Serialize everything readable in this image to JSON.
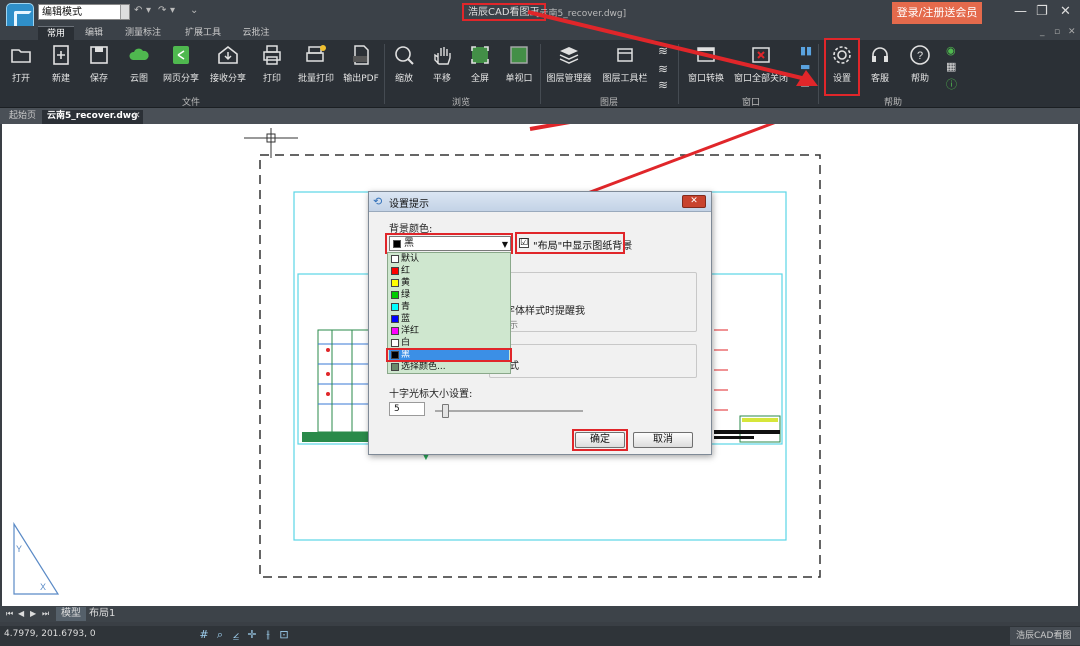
{
  "titlebar": {
    "mode_select": "编辑模式",
    "app_title": "浩辰CAD看图王",
    "file_title": "[云南5_recover.dwg]",
    "login_button": "登录/注册送会员"
  },
  "menu_tabs": [
    "常用",
    "编辑",
    "测量标注",
    "扩展工具",
    "云批注"
  ],
  "ribbon": {
    "file_buttons": [
      "打开",
      "新建",
      "保存",
      "云图",
      "网页分享",
      "接收分享",
      "打印",
      "批量打印",
      "输出PDF"
    ],
    "view_buttons": [
      "缩放",
      "平移",
      "全屏",
      "单视口"
    ],
    "layer_buttons": [
      "图层管理器",
      "图层工具栏"
    ],
    "window_buttons": [
      "窗口转换",
      "窗口全部关闭"
    ],
    "help_buttons": [
      "设置",
      "客服",
      "帮助"
    ],
    "groups": [
      "文件",
      "浏览",
      "图层",
      "窗口",
      "帮助"
    ]
  },
  "doc_tabs": {
    "start": "起始页",
    "file": "云南5_recover.dwg",
    "close": "✕"
  },
  "layout_tabs": {
    "nav": [
      "⏮",
      "◀",
      "▶",
      "⏭"
    ],
    "model": "模型",
    "layout1": "布局1"
  },
  "status": {
    "coords": "4.7979, 201.6793, 0",
    "app_name": "浩辰CAD看图王"
  },
  "dialog": {
    "title": "设置提示",
    "bg_color_label": "背景颜色:",
    "selected_color": "黑",
    "options": [
      {
        "label": "默认",
        "color": "#ffffff"
      },
      {
        "label": "红",
        "color": "#ff0000"
      },
      {
        "label": "黄",
        "color": "#ffff00"
      },
      {
        "label": "绿",
        "color": "#00cc00"
      },
      {
        "label": "青",
        "color": "#00ffff"
      },
      {
        "label": "蓝",
        "color": "#0000ff"
      },
      {
        "label": "洋红",
        "color": "#ff00ff"
      },
      {
        "label": "白",
        "color": "#ffffff"
      },
      {
        "label": "黑",
        "color": "#000000"
      },
      {
        "label": "选择颜色...",
        "color": "#6a8a6a"
      }
    ],
    "checkbox_label": "\"布局\"中显示图纸背景",
    "checkbox_checked": "☑",
    "group1_text": "失字体样式时提醒我",
    "group1_sub": "示",
    "group2_text": "式",
    "crosshair_label": "十字光标大小设置:",
    "crosshair_value": "5",
    "crosshair_slider_fraction": 0.05,
    "ok": "确定",
    "cancel": "取消"
  },
  "colors": {
    "highlight": "#e0262a",
    "accent": "#2f8fc9",
    "login": "#e46a4c"
  }
}
